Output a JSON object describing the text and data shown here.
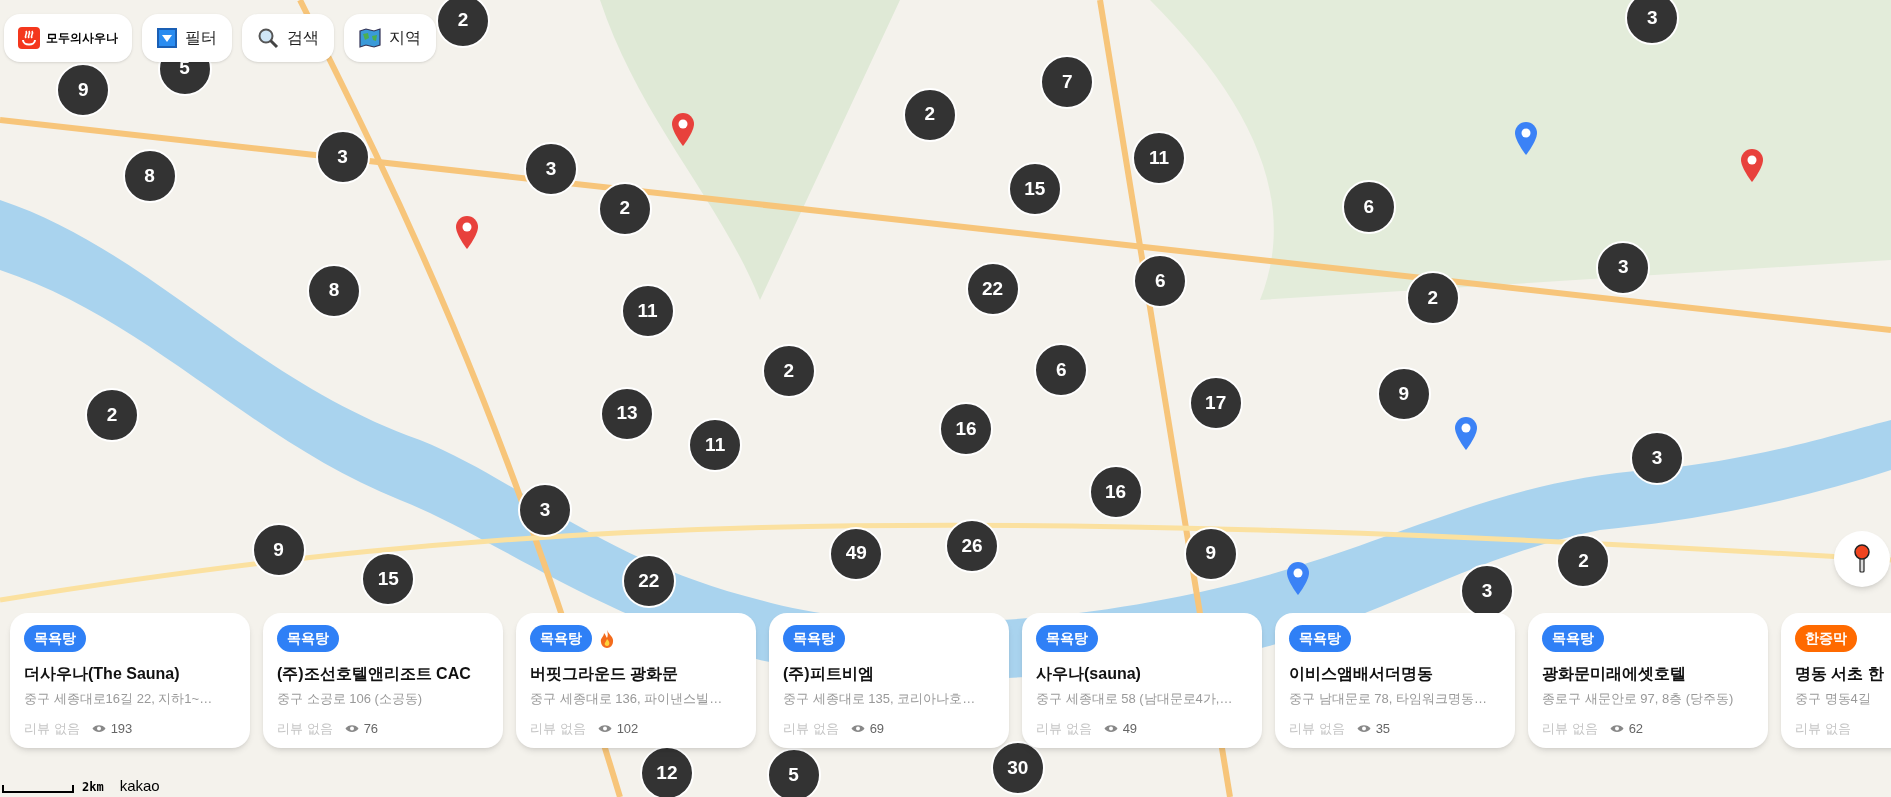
{
  "toolbar": {
    "logo_text": "모두의사우나",
    "buttons": [
      {
        "kind": "filter",
        "label": "필터"
      },
      {
        "kind": "search",
        "label": "검색"
      },
      {
        "kind": "region",
        "label": "지역"
      }
    ]
  },
  "clusters": [
    {
      "count": "2"
    },
    {
      "count": "9"
    },
    {
      "count": "5"
    },
    {
      "count": "8"
    },
    {
      "count": "3"
    },
    {
      "count": "3"
    },
    {
      "count": "2"
    },
    {
      "count": "8"
    },
    {
      "count": "11"
    },
    {
      "count": "2"
    },
    {
      "count": "7"
    },
    {
      "count": "11"
    },
    {
      "count": "15"
    },
    {
      "count": "22"
    },
    {
      "count": "6"
    },
    {
      "count": "3"
    },
    {
      "count": "6"
    },
    {
      "count": "2"
    },
    {
      "count": "3"
    },
    {
      "count": "2"
    },
    {
      "count": "13"
    },
    {
      "count": "2"
    },
    {
      "count": "6"
    },
    {
      "count": "17"
    },
    {
      "count": "9"
    },
    {
      "count": "11"
    },
    {
      "count": "16"
    },
    {
      "count": "3"
    },
    {
      "count": "3"
    },
    {
      "count": "16"
    },
    {
      "count": "9"
    },
    {
      "count": "49"
    },
    {
      "count": "26"
    },
    {
      "count": "9"
    },
    {
      "count": "2"
    },
    {
      "count": "22"
    },
    {
      "count": "15"
    },
    {
      "count": "3"
    },
    {
      "count": "12"
    },
    {
      "count": "5"
    },
    {
      "count": "30"
    }
  ],
  "cards": [
    {
      "badge": "목욕탕",
      "color": "#2f80f6",
      "hot": false,
      "name": "더사우나(The Sauna)",
      "address": "중구 세종대로16길 22, 지하1~…",
      "reviews": "리뷰 없음",
      "views": "193"
    },
    {
      "badge": "목욕탕",
      "color": "#2f80f6",
      "hot": false,
      "name": "(주)조선호텔앤리조트 CAC",
      "address": "중구 소공로 106 (소공동)",
      "reviews": "리뷰 없음",
      "views": "76"
    },
    {
      "badge": "목욕탕",
      "color": "#2f80f6",
      "hot": true,
      "name": "버핏그라운드 광화문",
      "address": "중구 세종대로 136, 파이낸스빌…",
      "reviews": "리뷰 없음",
      "views": "102"
    },
    {
      "badge": "목욕탕",
      "color": "#2f80f6",
      "hot": false,
      "name": "(주)피트비엠",
      "address": "중구 세종대로 135, 코리아나호…",
      "reviews": "리뷰 없음",
      "views": "69"
    },
    {
      "badge": "목욕탕",
      "color": "#2f80f6",
      "hot": false,
      "name": "사우나(sauna)",
      "address": "중구 세종대로 58 (남대문로4가,…",
      "reviews": "리뷰 없음",
      "views": "49"
    },
    {
      "badge": "목욕탕",
      "color": "#2f80f6",
      "hot": false,
      "name": "이비스앰배서더명동",
      "address": "중구 남대문로 78, 타임워크명동…",
      "reviews": "리뷰 없음",
      "views": "35"
    },
    {
      "badge": "목욕탕",
      "color": "#2f80f6",
      "hot": false,
      "name": "광화문미래에셋호텔",
      "address": "종로구 새문안로 97, 8층 (당주동)",
      "reviews": "리뷰 없음",
      "views": "62"
    },
    {
      "badge": "한증막",
      "color": "#ff6a00",
      "hot": false,
      "name": "명동 서초 한",
      "address": "중구 명동4길",
      "reviews": "리뷰 없음"
    }
  ],
  "scale": {
    "distance": "2km",
    "attribution": "kakao"
  }
}
